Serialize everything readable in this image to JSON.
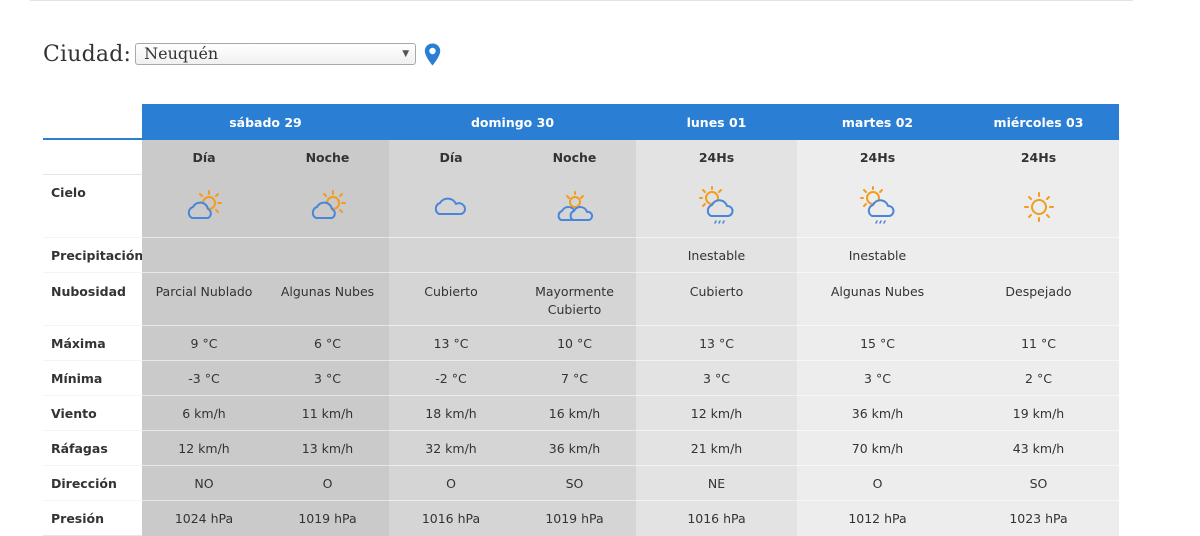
{
  "city": {
    "label": "Ciudad:",
    "selected": "Neuquén",
    "arrow": "▼",
    "icon": "location-pin-icon"
  },
  "colors": {
    "header_blue": "#2a7ed4",
    "sun": "#f39c1f",
    "cloud": "#4a86d8",
    "pin": "#2a7ed4"
  },
  "days": [
    {
      "name": "sábado 29"
    },
    {
      "name": "domingo 30"
    },
    {
      "name": "lunes 01"
    },
    {
      "name": "martes 02"
    },
    {
      "name": "miércoles 03"
    }
  ],
  "periods": [
    "Día",
    "Noche",
    "Día",
    "Noche",
    "24Hs",
    "24Hs",
    "24Hs"
  ],
  "labels": {
    "cielo": "Cielo",
    "precipitacion": "Precipitación",
    "nubosidad": "Nubosidad",
    "maxima": "Máxima",
    "minima": "Mínima",
    "viento": "Viento",
    "rafagas": "Ráfagas",
    "direccion": "Dirección",
    "presion": "Presión"
  },
  "sky_icons": [
    "partly-cloudy-icon",
    "partly-cloudy-night-icon",
    "cloudy-icon",
    "mostly-cloudy-icon",
    "cloud-sun-rain-icon",
    "cloud-sun-rain-icon",
    "sun-icon"
  ],
  "precipitacion": [
    "",
    "",
    "",
    "",
    "Inestable",
    "Inestable",
    ""
  ],
  "nubosidad": [
    "Parcial Nublado",
    "Algunas Nubes",
    "Cubierto",
    "Mayormente Cubierto",
    "Cubierto",
    "Algunas Nubes",
    "Despejado"
  ],
  "maxima": [
    "9 °C",
    "6 °C",
    "13 °C",
    "10 °C",
    "13 °C",
    "15 °C",
    "11 °C"
  ],
  "minima": [
    "-3 °C",
    "3 °C",
    "-2 °C",
    "7 °C",
    "3 °C",
    "3 °C",
    "2 °C"
  ],
  "viento": [
    "6 km/h",
    "11 km/h",
    "18 km/h",
    "16 km/h",
    "12 km/h",
    "36 km/h",
    "19 km/h"
  ],
  "rafagas": [
    "12 km/h",
    "13 km/h",
    "32 km/h",
    "36 km/h",
    "21 km/h",
    "70 km/h",
    "43 km/h"
  ],
  "direccion": [
    "NO",
    "O",
    "O",
    "SO",
    "NE",
    "O",
    "SO"
  ],
  "presion": [
    "1024 hPa",
    "1019 hPa",
    "1016 hPa",
    "1019 hPa",
    "1016 hPa",
    "1012 hPa",
    "1023 hPa"
  ]
}
